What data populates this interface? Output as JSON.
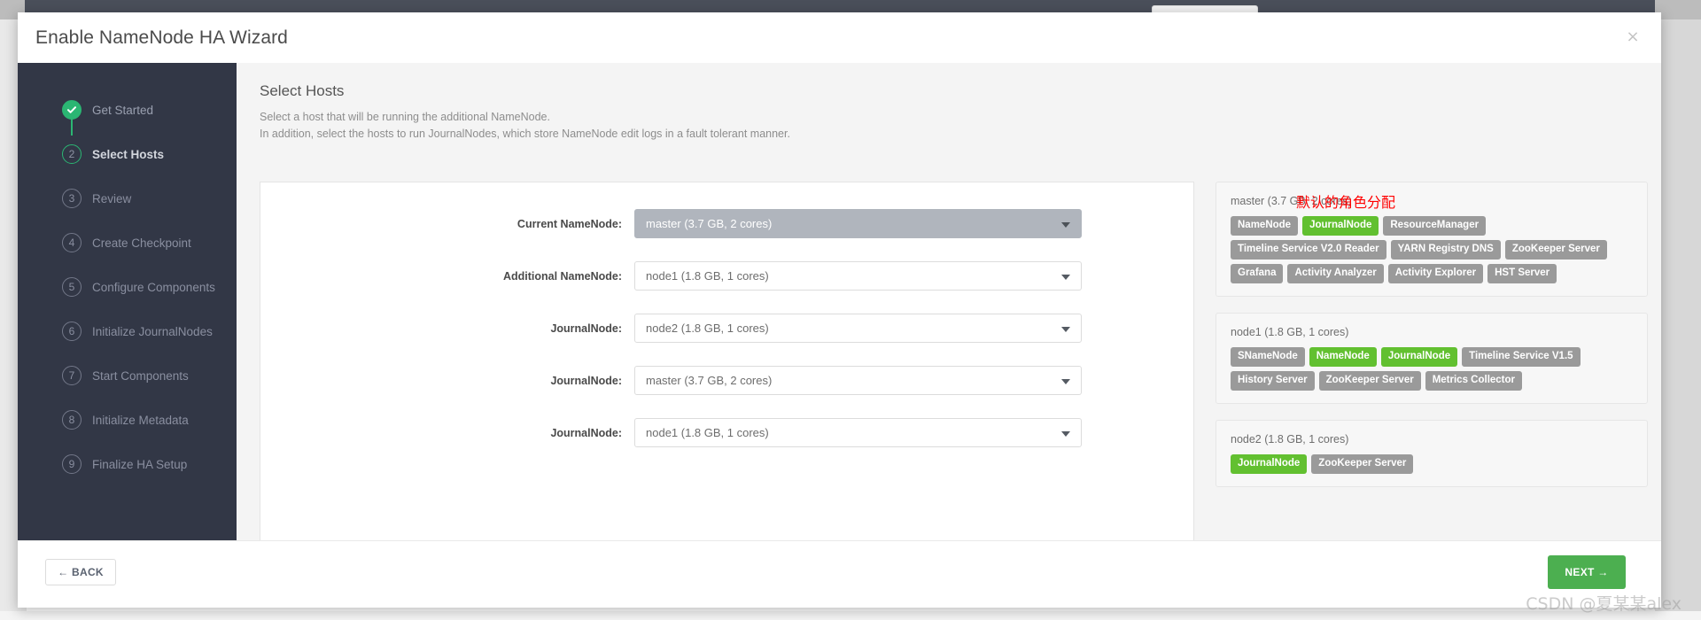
{
  "window": {
    "title": "Enable NameNode HA Wizard",
    "close_icon": "close-icon",
    "close_glyph": "×"
  },
  "sidebar": {
    "steps": [
      {
        "num": "✓",
        "label": "Get Started",
        "state": "done"
      },
      {
        "num": "2",
        "label": "Select Hosts",
        "state": "current"
      },
      {
        "num": "3",
        "label": "Review",
        "state": "pending"
      },
      {
        "num": "4",
        "label": "Create Checkpoint",
        "state": "pending"
      },
      {
        "num": "5",
        "label": "Configure Components",
        "state": "pending"
      },
      {
        "num": "6",
        "label": "Initialize JournalNodes",
        "state": "pending"
      },
      {
        "num": "7",
        "label": "Start Components",
        "state": "pending"
      },
      {
        "num": "8",
        "label": "Initialize Metadata",
        "state": "pending"
      },
      {
        "num": "9",
        "label": "Finalize HA Setup",
        "state": "pending"
      }
    ]
  },
  "content": {
    "title": "Select Hosts",
    "subtitle_line1": "Select a host that will be running the additional NameNode.",
    "subtitle_line2": "In addition, select the hosts to run JournalNodes, which store NameNode edit logs in a fault tolerant manner.",
    "annotation": "默认的角色分配",
    "annotation_color": "#ff0000"
  },
  "form": {
    "rows": [
      {
        "label": "Current NameNode:",
        "value": "master (3.7 GB, 2 cores)",
        "disabled": true
      },
      {
        "label": "Additional NameNode:",
        "value": "node1 (1.8 GB, 1 cores)",
        "disabled": false
      },
      {
        "label": "JournalNode:",
        "value": "node2 (1.8 GB, 1 cores)",
        "disabled": false
      },
      {
        "label": "JournalNode:",
        "value": "master (3.7 GB, 2 cores)",
        "disabled": false
      },
      {
        "label": "JournalNode:",
        "value": "node1 (1.8 GB, 1 cores)",
        "disabled": false
      }
    ]
  },
  "hosts": [
    {
      "name": "master (3.7 GB, 2 cores)",
      "badges": [
        {
          "label": "NameNode",
          "highlight": false
        },
        {
          "label": "JournalNode",
          "highlight": true
        },
        {
          "label": "ResourceManager",
          "highlight": false
        },
        {
          "label": "Timeline Service V2.0 Reader",
          "highlight": false
        },
        {
          "label": "YARN Registry DNS",
          "highlight": false
        },
        {
          "label": "ZooKeeper Server",
          "highlight": false
        },
        {
          "label": "Grafana",
          "highlight": false
        },
        {
          "label": "Activity Analyzer",
          "highlight": false
        },
        {
          "label": "Activity Explorer",
          "highlight": false
        },
        {
          "label": "HST Server",
          "highlight": false
        }
      ]
    },
    {
      "name": "node1 (1.8 GB, 1 cores)",
      "badges": [
        {
          "label": "SNameNode",
          "highlight": false
        },
        {
          "label": "NameNode",
          "highlight": true
        },
        {
          "label": "JournalNode",
          "highlight": true
        },
        {
          "label": "Timeline Service V1.5",
          "highlight": false
        },
        {
          "label": "History Server",
          "highlight": false
        },
        {
          "label": "ZooKeeper Server",
          "highlight": false
        },
        {
          "label": "Metrics Collector",
          "highlight": false
        }
      ]
    },
    {
      "name": "node2 (1.8 GB, 1 cores)",
      "badges": [
        {
          "label": "JournalNode",
          "highlight": true
        },
        {
          "label": "ZooKeeper Server",
          "highlight": false
        }
      ]
    }
  ],
  "footer": {
    "back_label": "← BACK",
    "next_label": "NEXT →",
    "next_color": "#4caf50"
  },
  "watermark": "CSDN @夏某某alex"
}
